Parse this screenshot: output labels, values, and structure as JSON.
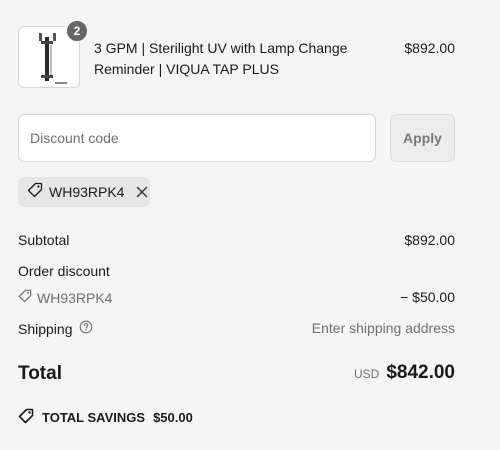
{
  "product": {
    "quantity_badge": "2",
    "title": "3 GPM | Sterilight UV with Lamp Change Reminder | VIQUA TAP PLUS",
    "price": "$892.00",
    "thumbnail_icon": "uv-sterilizer-product-image"
  },
  "discount": {
    "placeholder": "Discount code",
    "apply_label": "Apply",
    "applied_code": "WH93RPK4",
    "tag_icon": "tag-icon",
    "remove_icon": "close-icon"
  },
  "summary": {
    "subtotal_label": "Subtotal",
    "subtotal_value": "$892.00",
    "order_discount_label": "Order discount",
    "order_discount_code": "WH93RPK4",
    "order_discount_value": "− $50.00",
    "shipping_label": "Shipping",
    "shipping_value": "Enter shipping address",
    "total_label": "Total",
    "currency": "USD",
    "total_value": "$842.00",
    "savings_label": "TOTAL SAVINGS",
    "savings_value": "$50.00"
  }
}
